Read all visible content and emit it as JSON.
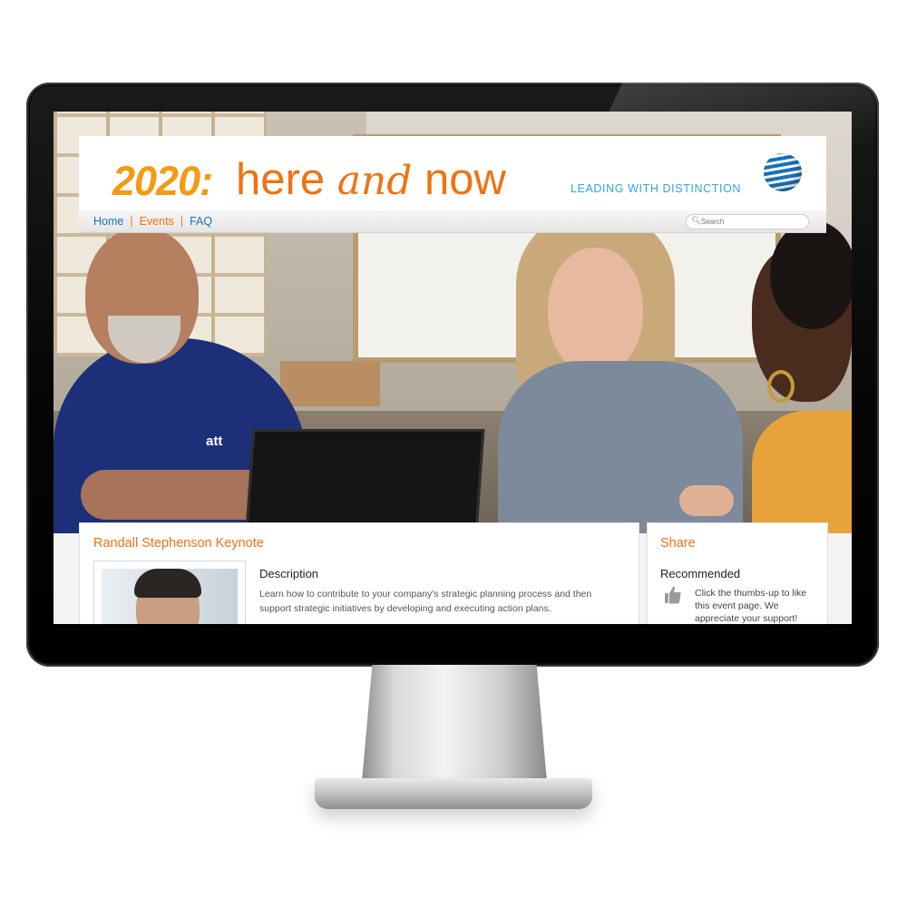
{
  "header": {
    "year": "2020:",
    "title_here": "here ",
    "title_and": "and",
    "title_now": " now",
    "tagline": "LEADING WITH DISTINCTION",
    "logo_icon": "att-globe-icon",
    "brand_colors": {
      "orange": "#ef7313",
      "amber": "#f39b13",
      "blue": "#31a6d9"
    }
  },
  "nav": {
    "items": [
      {
        "label": "Home",
        "active": false
      },
      {
        "label": "Events",
        "active": true
      },
      {
        "label": "FAQ",
        "active": false
      }
    ],
    "separator": "|"
  },
  "search": {
    "placeholder": "Search",
    "icon": "search-icon"
  },
  "hero": {
    "shirt_logo": "att"
  },
  "main_card": {
    "title": "Randall Stephenson Keynote",
    "description_heading": "Description",
    "description_text": "Learn how to contribute to your company's strategic planning process and then support strategic initiatives by developing and executing action plans."
  },
  "side_card": {
    "title": "Share",
    "recommended_heading": "Recommended",
    "recommended_text": "Click the thumbs-up to like this event page. We appreciate your support!",
    "thumb_icon": "thumbs-up-icon"
  }
}
